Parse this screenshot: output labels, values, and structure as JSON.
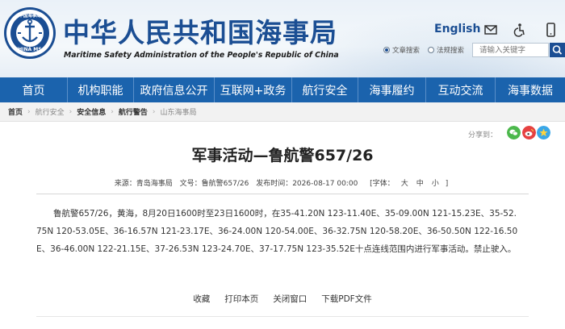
{
  "header": {
    "title": "中华人民共和国海事局",
    "subtitle": "Maritime Safety Administration of the People's Republic of China",
    "logo_text": "CHINA MSA",
    "logo_top_text": "中国海事局",
    "lang_link": "English",
    "icons": [
      "email-icon",
      "accessibility-icon",
      "mobile-icon"
    ],
    "search": {
      "option_fulltext": "文章搜索",
      "option_rules": "法规搜索",
      "placeholder": "请输入关键字",
      "selected": "文章搜索"
    },
    "colors": {
      "brand": "#1b4e93",
      "nav": "#1b63ad"
    }
  },
  "nav": {
    "items": [
      {
        "label": "首页"
      },
      {
        "label": "机构职能"
      },
      {
        "label": "政府信息公开"
      },
      {
        "label": "互联网+政务"
      },
      {
        "label": "航行安全"
      },
      {
        "label": "海事履约"
      },
      {
        "label": "互动交流"
      },
      {
        "label": "海事数据"
      }
    ]
  },
  "breadcrumb": {
    "items": [
      {
        "label": "首页",
        "bold": true
      },
      {
        "label": "航行安全",
        "bold": false
      },
      {
        "label": "安全信息",
        "bold": true
      },
      {
        "label": "航行警告",
        "bold": true
      },
      {
        "label": "山东海事局",
        "bold": false
      }
    ]
  },
  "share": {
    "label": "分享到：",
    "icons": [
      "wechat-icon",
      "weibo-icon",
      "qzone-icon"
    ]
  },
  "article": {
    "title": "军事活动—鲁航警657/26",
    "meta": {
      "source": "来源：青岛海事局",
      "doc_no": "文号：鲁航警657/26",
      "date": "发布时间：2026-08-17 00:00",
      "font_label": "[字体：",
      "font_large": "大",
      "font_medium": "中",
      "font_small": "小",
      "font_close": "]"
    },
    "body": "鲁航警657/26，黄海，8月20日1600时至23日1600时，在35-41.20N 123-11.40E、35-09.00N 121-15.23E、35-52.75N 120-53.05E、36-16.57N 121-23.17E、36-24.00N 120-54.00E、36-32.75N 120-58.20E、36-50.50N 122-16.50E、36-46.00N 122-21.15E、37-26.53N 123-24.70E、37-17.75N 123-35.52E十点连线范围内进行军事活动。禁止驶入。"
  },
  "actions": {
    "favorite": "收藏",
    "print": "打印本页",
    "close": "关闭窗口",
    "pdf": "下载PDF文件"
  }
}
